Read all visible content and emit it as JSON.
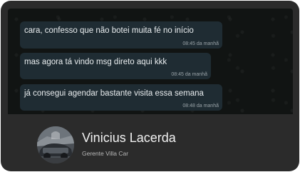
{
  "messages": [
    {
      "text": "cara, confesso que não botei muita fé no início",
      "time": "08:45 da manhã"
    },
    {
      "text": "mas agora tá vindo msg direto aqui kkk",
      "time": "08:45 da manhã"
    },
    {
      "text": "já consegui agendar bastante visita essa semana",
      "time": "08:48 da manhã"
    }
  ],
  "profile": {
    "name": "Vinicius Lacerda",
    "role": "Gerente Villa Car"
  },
  "colors": {
    "card": "#2b2b2b",
    "chat_background": "#111413",
    "bubble": "#1f2c33"
  }
}
